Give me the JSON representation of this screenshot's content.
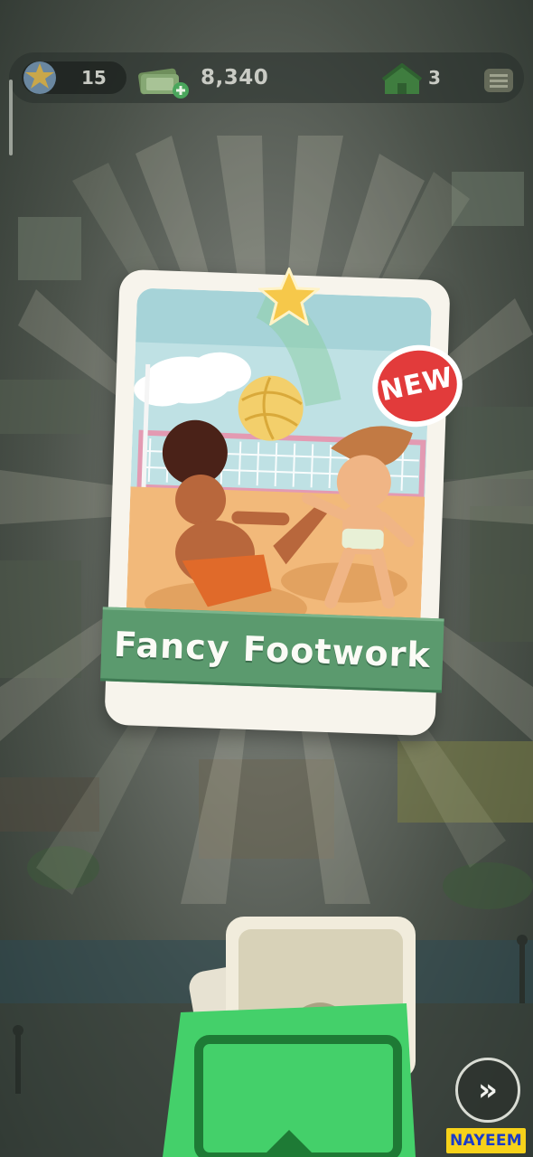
{
  "hud": {
    "level": "15",
    "cash": "8,340",
    "houses": "3"
  },
  "card": {
    "title": "Fancy Footwork",
    "badge": "NEW"
  },
  "controls": {
    "skip_label": "»"
  },
  "watermark": "NAYEEM",
  "colors": {
    "banner": "#5b9a6e",
    "badge": "#e23b3b",
    "watermark_bg": "#f7d21a",
    "watermark_text": "#1c3cc7"
  },
  "icons": [
    "level-badge-icon",
    "cash-stack-icon",
    "house-icon",
    "menu-icon",
    "star-icon",
    "card-pack-icon",
    "fast-forward-icon"
  ]
}
